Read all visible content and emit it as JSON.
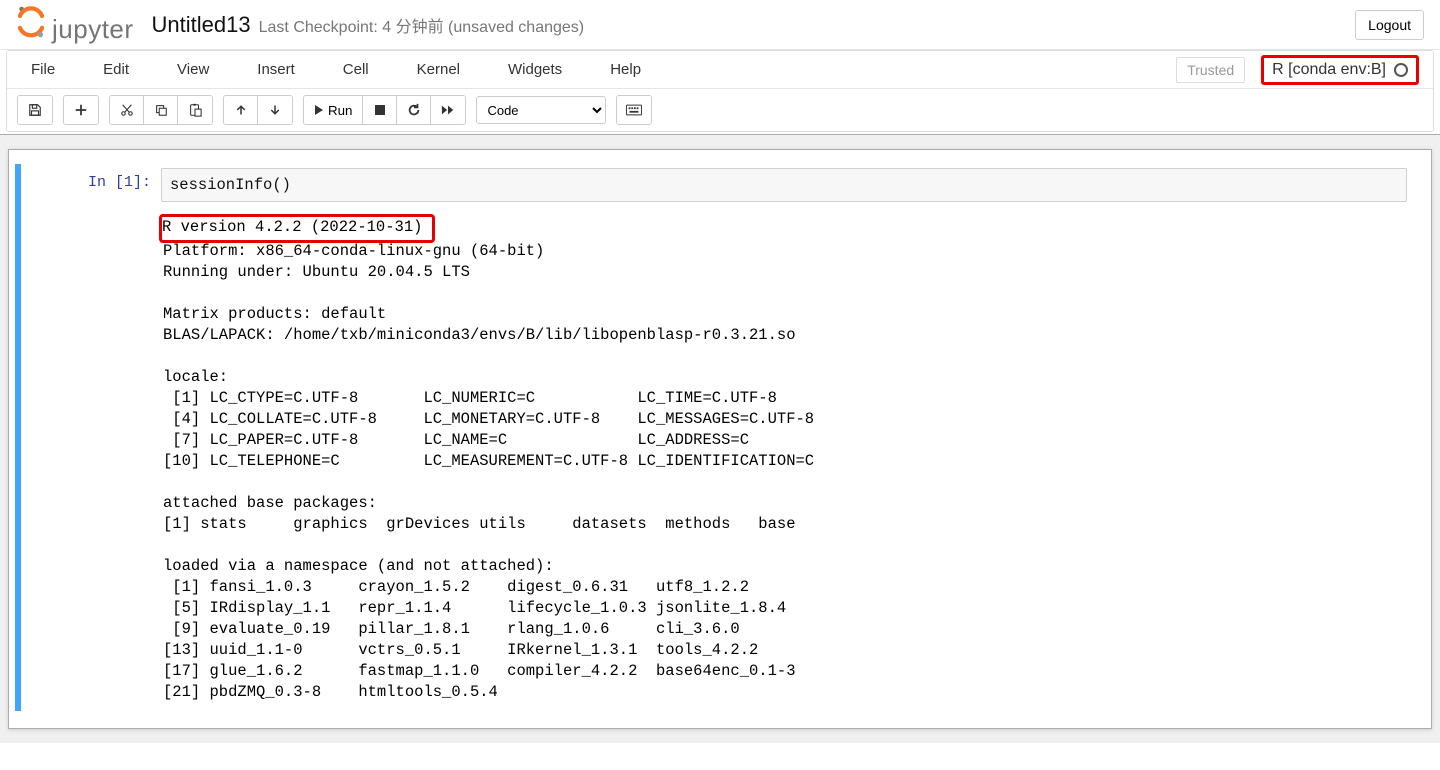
{
  "header": {
    "logo_text": "jupyter",
    "title": "Untitled13",
    "checkpoint": "Last Checkpoint: 4 分钟前  (unsaved changes)",
    "logout": "Logout"
  },
  "menubar": {
    "file": "File",
    "edit": "Edit",
    "view": "View",
    "insert": "Insert",
    "cell": "Cell",
    "kernel": "Kernel",
    "widgets": "Widgets",
    "help": "Help",
    "trusted": "Trusted",
    "kernel_name": "R [conda env:B]"
  },
  "toolbar": {
    "run_label": "Run",
    "celltype_value": "Code"
  },
  "cell": {
    "in_prompt": "In  [1]:",
    "code": "sessionInfo()",
    "output": {
      "l1": "R version 4.2.2 (2022-10-31)",
      "l2": "Platform: x86_64-conda-linux-gnu (64-bit)",
      "l3": "Running under: Ubuntu 20.04.5 LTS",
      "l4": "",
      "l5": "Matrix products: default",
      "l6": "BLAS/LAPACK: /home/txb/miniconda3/envs/B/lib/libopenblasp-r0.3.21.so",
      "l7": "",
      "l8": "locale:",
      "l9": " [1] LC_CTYPE=C.UTF-8       LC_NUMERIC=C           LC_TIME=C.UTF-8       ",
      "l10": " [4] LC_COLLATE=C.UTF-8     LC_MONETARY=C.UTF-8    LC_MESSAGES=C.UTF-8   ",
      "l11": " [7] LC_PAPER=C.UTF-8       LC_NAME=C              LC_ADDRESS=C          ",
      "l12": "[10] LC_TELEPHONE=C         LC_MEASUREMENT=C.UTF-8 LC_IDENTIFICATION=C   ",
      "l13": "",
      "l14": "attached base packages:",
      "l15": "[1] stats     graphics  grDevices utils     datasets  methods   base     ",
      "l16": "",
      "l17": "loaded via a namespace (and not attached):",
      "l18": " [1] fansi_1.0.3     crayon_1.5.2    digest_0.6.31   utf8_1.2.2     ",
      "l19": " [5] IRdisplay_1.1   repr_1.1.4      lifecycle_1.0.3 jsonlite_1.8.4 ",
      "l20": " [9] evaluate_0.19   pillar_1.8.1    rlang_1.0.6     cli_3.6.0      ",
      "l21": "[13] uuid_1.1-0      vctrs_0.5.1     IRkernel_1.3.1  tools_4.2.2    ",
      "l22": "[17] glue_1.6.2      fastmap_1.1.0   compiler_4.2.2  base64enc_0.1-3",
      "l23": "[21] pbdZMQ_0.3-8    htmltools_0.5.4"
    }
  }
}
